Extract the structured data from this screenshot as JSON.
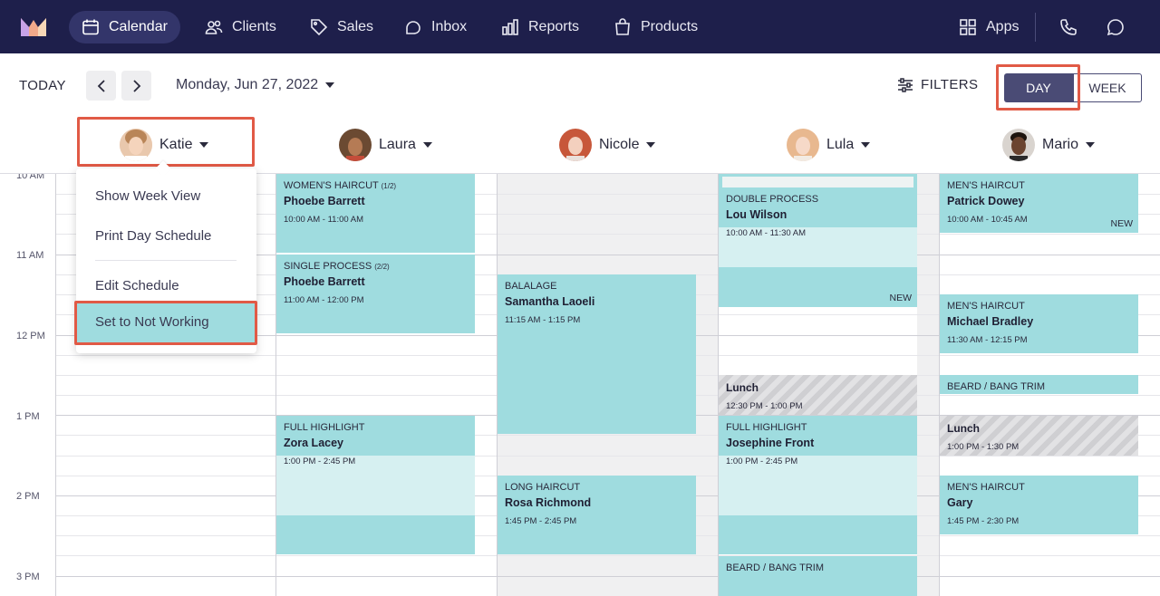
{
  "nav": {
    "items": [
      {
        "label": "Calendar",
        "icon": "calendar-icon"
      },
      {
        "label": "Clients",
        "icon": "clients-icon"
      },
      {
        "label": "Sales",
        "icon": "tag-icon"
      },
      {
        "label": "Inbox",
        "icon": "inbox-icon"
      },
      {
        "label": "Reports",
        "icon": "bar-chart-icon"
      },
      {
        "label": "Products",
        "icon": "shopping-bag-icon"
      }
    ],
    "apps_label": "Apps",
    "active": "Calendar"
  },
  "toolbar": {
    "today_label": "TODAY",
    "date_label": "Monday, Jun 27, 2022",
    "filters_label": "FILTERS",
    "day_label": "DAY",
    "week_label": "WEEK"
  },
  "staff": [
    {
      "name": "Katie"
    },
    {
      "name": "Laura"
    },
    {
      "name": "Nicole"
    },
    {
      "name": "Lula"
    },
    {
      "name": "Mario"
    }
  ],
  "time_labels": [
    "10 AM",
    "11 AM",
    "12 PM",
    "1 PM",
    "2 PM",
    "3 PM"
  ],
  "menu": {
    "show_week": "Show Week View",
    "print_day": "Print Day Schedule",
    "edit_schedule": "Edit Schedule",
    "not_working": "Set to Not Working"
  },
  "appointments": {
    "laura_1": {
      "service": "WOMEN'S HAIRCUT",
      "part": "(1/2)",
      "client": "Phoebe Barrett",
      "time": "10:00 AM - 11:00 AM"
    },
    "laura_2": {
      "service": "SINGLE PROCESS",
      "part": "(2/2)",
      "client": "Phoebe Barrett",
      "time": "11:00 AM - 12:00 PM"
    },
    "laura_3": {
      "service": "FULL HIGHLIGHT",
      "client": "Zora Lacey",
      "time": "1:00 PM - 2:45 PM"
    },
    "nicole_1": {
      "service": "BALALAGE",
      "client": "Samantha Laoeli",
      "time": "11:15 AM - 1:15 PM"
    },
    "nicole_2": {
      "service": "LONG HAIRCUT",
      "client": "Rosa Richmond",
      "time": "1:45 PM - 2:45 PM"
    },
    "lula_1": {
      "service": "DOUBLE PROCESS",
      "client": "Lou Wilson",
      "time": "10:00 AM - 11:30 AM",
      "badge": "NEW"
    },
    "lula_lunch": {
      "client": "Lunch",
      "time": "12:30 PM - 1:00 PM"
    },
    "lula_2": {
      "service": "FULL HIGHLIGHT",
      "client": "Josephine Front",
      "time": "1:00 PM - 2:45 PM"
    },
    "lula_3": {
      "service": "BEARD / BANG TRIM"
    },
    "mario_1": {
      "service": "MEN'S HAIRCUT",
      "client": "Patrick Dowey",
      "time": "10:00 AM - 10:45 AM",
      "badge": "NEW"
    },
    "mario_2": {
      "service": "MEN'S HAIRCUT",
      "client": "Michael Bradley",
      "time": "11:30 AM - 12:15 PM"
    },
    "mario_3": {
      "service": "BEARD / BANG TRIM"
    },
    "mario_lunch": {
      "client": "Lunch",
      "time": "1:00 PM - 1:30 PM"
    },
    "mario_4": {
      "service": "MEN'S HAIRCUT",
      "client": "Gary",
      "time": "1:45 PM - 2:30 PM"
    }
  }
}
